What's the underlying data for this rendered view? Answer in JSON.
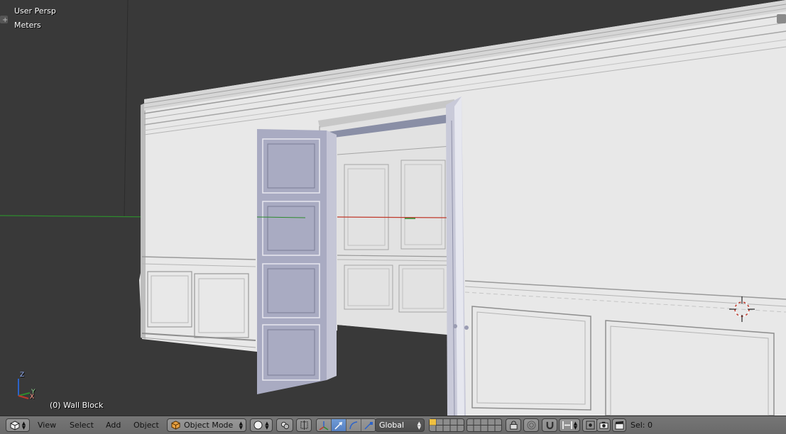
{
  "viewport": {
    "view_name": "User Persp",
    "units": "Meters",
    "object_info": "(0) Wall Block",
    "axis_z_label": "Z",
    "axis_y_label": "Y",
    "axis_x_label": "X"
  },
  "header": {
    "menus": [
      "View",
      "Select",
      "Add",
      "Object"
    ],
    "mode": "Object Mode",
    "orientation": "Global",
    "selection_text": "Sel: 0"
  },
  "icons": {
    "editor_type": "cube-icon",
    "shading": "sphere-icon",
    "pivot": "pivot-icon",
    "manipulator": "axis-manipulator-icon",
    "translate": "translate-arrow-icon",
    "rotate": "rotate-arc-icon",
    "scale": "scale-icon",
    "layers": "layer-grid-icon",
    "lock": "lock-icon",
    "proportional": "proportional-edit-icon",
    "snap": "magnet-icon",
    "snap_element": "snap-element-icon",
    "render": "camera-icon",
    "clapper": "clapper-icon"
  },
  "colors": {
    "background": "#393939",
    "toolbar": "#727272",
    "accent_selected": "#5680c2",
    "x_axis": "#c0392b",
    "y_axis": "#2e8b2e",
    "z_axis": "#2c63c9"
  }
}
